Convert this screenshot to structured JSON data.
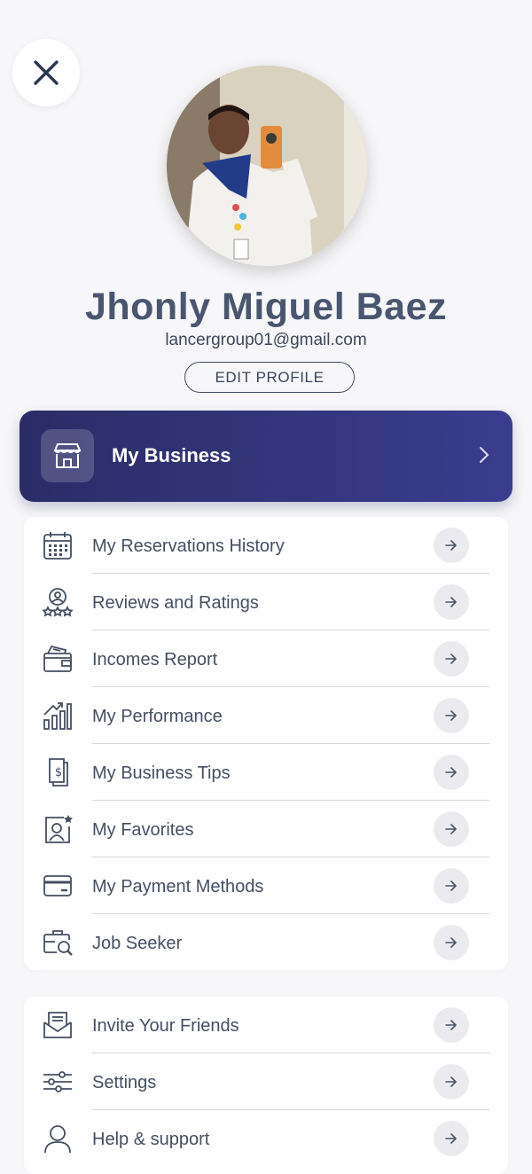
{
  "profile": {
    "name": "Jhonly Miguel Baez",
    "email": "lancergroup01@gmail.com",
    "edit_label": "EDIT PROFILE"
  },
  "business": {
    "label": "My Business",
    "accent_from": "#2b2c66",
    "accent_to": "#3a3d8e"
  },
  "menu_main": [
    {
      "label": "My Reservations History",
      "icon": "calendar-icon"
    },
    {
      "label": "Reviews and Ratings",
      "icon": "rating-award-icon"
    },
    {
      "label": "Incomes Report",
      "icon": "wallet-icon"
    },
    {
      "label": "My Performance",
      "icon": "performance-chart-icon"
    },
    {
      "label": "My Business Tips",
      "icon": "tips-receipt-icon"
    },
    {
      "label": "My Favorites",
      "icon": "favorite-user-icon"
    },
    {
      "label": "My Payment Methods",
      "icon": "credit-card-icon"
    },
    {
      "label": "Job Seeker",
      "icon": "job-search-icon"
    }
  ],
  "menu_secondary": [
    {
      "label": "Invite Your Friends",
      "icon": "invite-mail-icon"
    },
    {
      "label": "Settings",
      "icon": "settings-sliders-icon"
    },
    {
      "label": "Help & support",
      "icon": "help-user-icon"
    }
  ],
  "colors": {
    "text": "#454f62",
    "name": "#4a5670",
    "background": "#f7f7f9",
    "arrow_bg": "#ebebef"
  }
}
